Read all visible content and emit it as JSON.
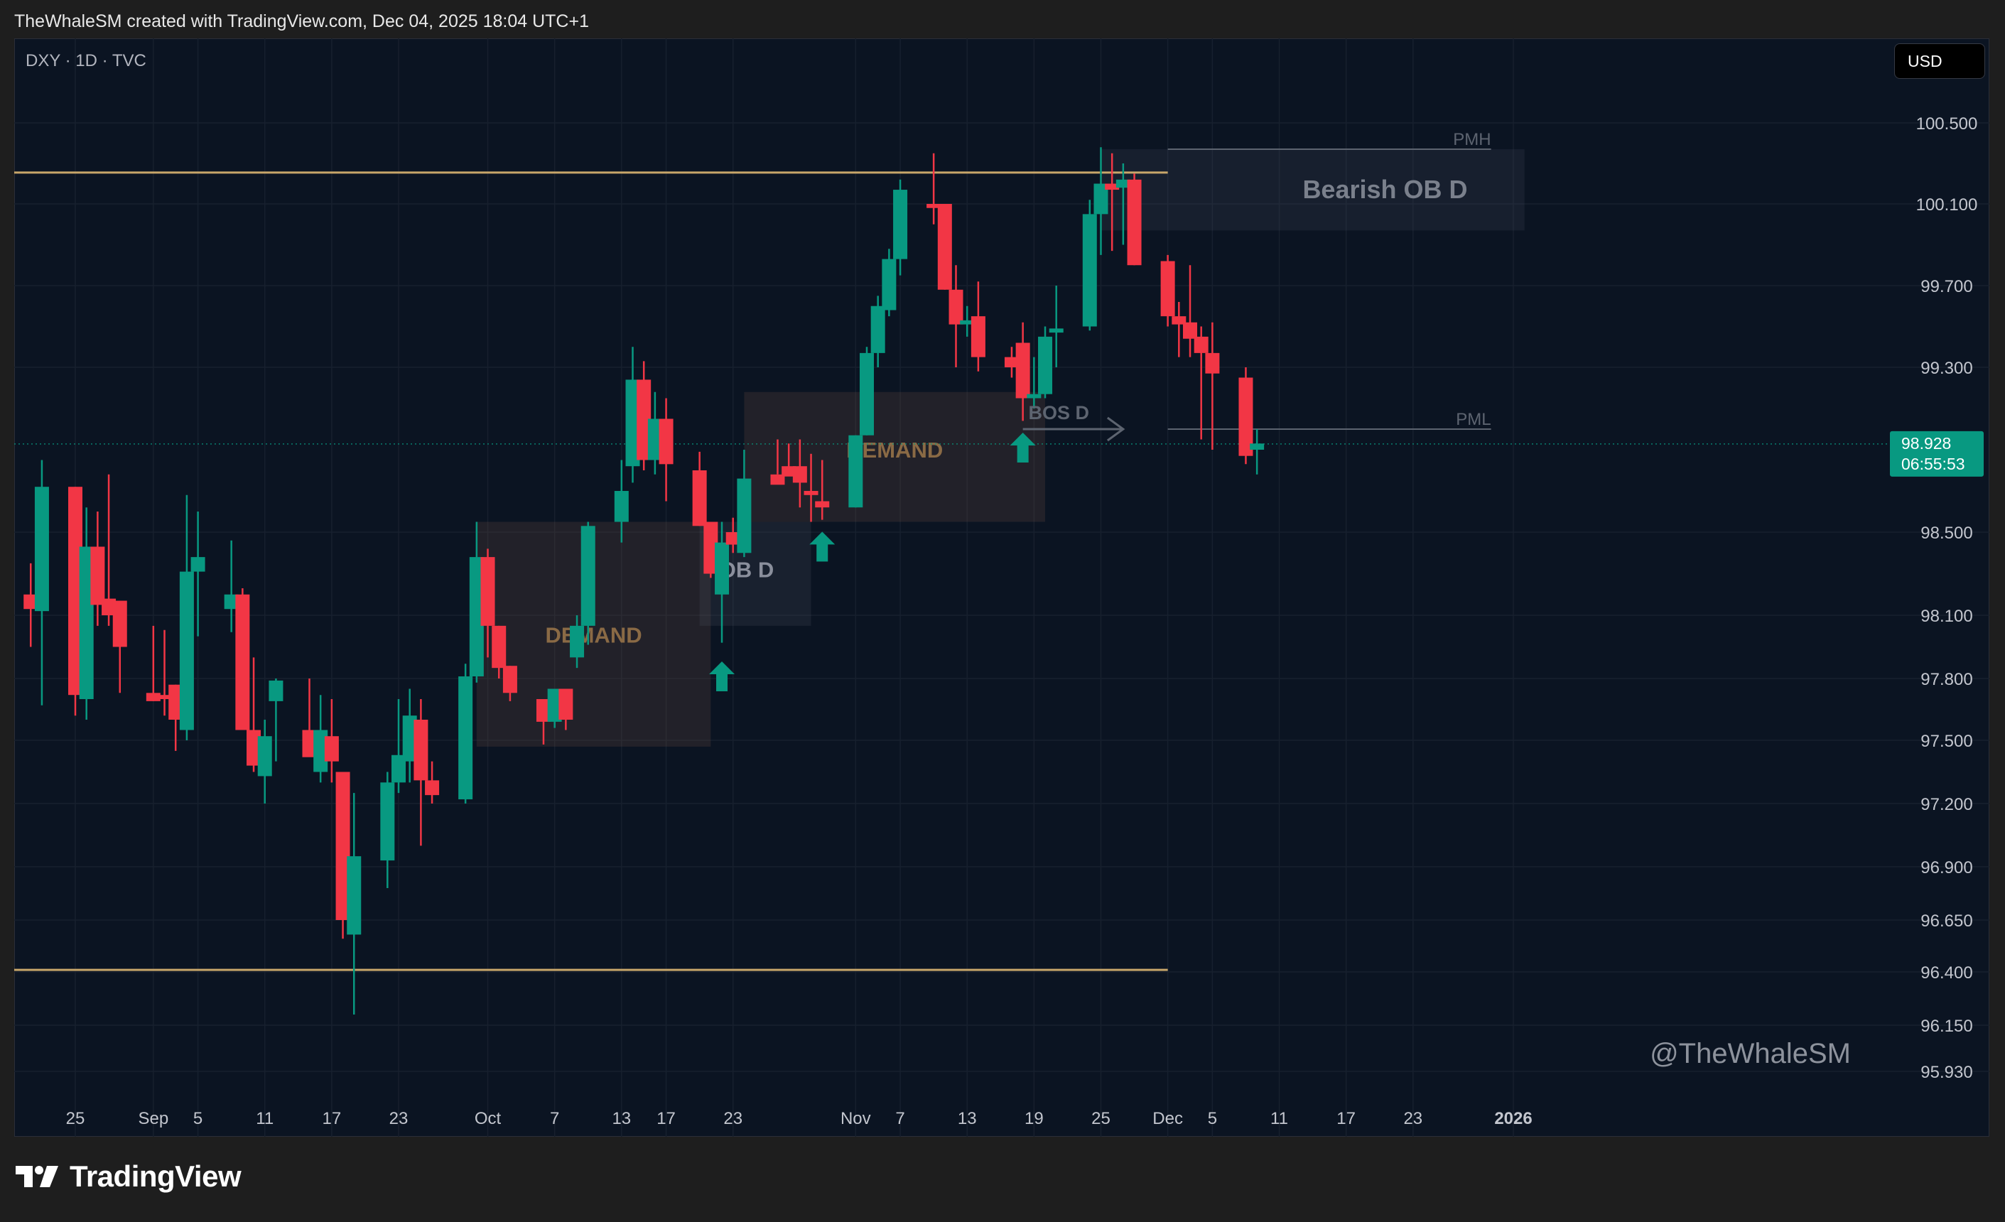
{
  "header": {
    "credit": "TheWhaleSM created with TradingView.com, Dec 04, 2025 18:04 UTC+1"
  },
  "symbol": {
    "label": "DXY · 1D · TVC"
  },
  "currency": "USD",
  "brand": {
    "name": "TradingView",
    "logo_icon": "tradingview-logo-icon"
  },
  "watermark": "@TheWhaleSM",
  "colors": {
    "up": "#089981",
    "down": "#f23645",
    "level": "#c8a66a",
    "price_badge": "#089981"
  },
  "chart_data": {
    "type": "candlestick",
    "y_ticks": [
      "100.500",
      "100.100",
      "99.700",
      "99.300",
      "98.500",
      "98.100",
      "97.800",
      "97.500",
      "97.200",
      "96.900",
      "96.650",
      "96.400",
      "96.150",
      "95.930"
    ],
    "x_ticks": [
      {
        "label": "25",
        "date": "2025-08-25"
      },
      {
        "label": "Sep",
        "date": "2025-09-01"
      },
      {
        "label": "5",
        "date": "2025-09-05"
      },
      {
        "label": "11",
        "date": "2025-09-11"
      },
      {
        "label": "17",
        "date": "2025-09-17"
      },
      {
        "label": "23",
        "date": "2025-09-23"
      },
      {
        "label": "Oct",
        "date": "2025-10-01"
      },
      {
        "label": "7",
        "date": "2025-10-07"
      },
      {
        "label": "13",
        "date": "2025-10-13"
      },
      {
        "label": "17",
        "date": "2025-10-17"
      },
      {
        "label": "23",
        "date": "2025-10-23"
      },
      {
        "label": "Nov",
        "date": "2025-11-03"
      },
      {
        "label": "7",
        "date": "2025-11-07"
      },
      {
        "label": "13",
        "date": "2025-11-13"
      },
      {
        "label": "19",
        "date": "2025-11-19"
      },
      {
        "label": "25",
        "date": "2025-11-25"
      },
      {
        "label": "Dec",
        "date": "2025-12-01"
      },
      {
        "label": "5",
        "date": "2025-12-05"
      },
      {
        "label": "11",
        "date": "2025-12-11"
      },
      {
        "label": "17",
        "date": "2025-12-17"
      },
      {
        "label": "23",
        "date": "2025-12-23"
      },
      {
        "label": "2026",
        "date": "2026-01-01"
      }
    ],
    "candles": [
      {
        "date": "2025-08-21",
        "o": 98.2,
        "h": 98.35,
        "l": 97.95,
        "c": 98.13
      },
      {
        "date": "2025-08-22",
        "o": 98.12,
        "h": 98.85,
        "l": 97.67,
        "c": 98.72
      },
      {
        "date": "2025-08-25",
        "o": 98.72,
        "h": 98.72,
        "l": 97.62,
        "c": 97.72
      },
      {
        "date": "2025-08-26",
        "o": 97.7,
        "h": 98.62,
        "l": 97.6,
        "c": 98.43
      },
      {
        "date": "2025-08-27",
        "o": 98.43,
        "h": 98.6,
        "l": 98.05,
        "c": 98.15
      },
      {
        "date": "2025-08-28",
        "o": 98.18,
        "h": 98.78,
        "l": 98.05,
        "c": 98.1
      },
      {
        "date": "2025-08-29",
        "o": 98.17,
        "h": 98.17,
        "l": 97.73,
        "c": 97.95
      },
      {
        "date": "2025-09-01",
        "o": 97.73,
        "h": 98.05,
        "l": 97.69,
        "c": 97.69
      },
      {
        "date": "2025-09-02",
        "o": 97.72,
        "h": 98.03,
        "l": 97.62,
        "c": 97.7
      },
      {
        "date": "2025-09-03",
        "o": 97.77,
        "h": 97.77,
        "l": 97.45,
        "c": 97.6
      },
      {
        "date": "2025-09-04",
        "o": 97.55,
        "h": 98.68,
        "l": 97.5,
        "c": 98.31
      },
      {
        "date": "2025-09-05",
        "o": 98.31,
        "h": 98.6,
        "l": 98.0,
        "c": 98.38
      },
      {
        "date": "2025-09-08",
        "o": 98.13,
        "h": 98.46,
        "l": 98.02,
        "c": 98.2
      },
      {
        "date": "2025-09-09",
        "o": 98.2,
        "h": 98.23,
        "l": 97.55,
        "c": 97.55
      },
      {
        "date": "2025-09-10",
        "o": 97.55,
        "h": 97.9,
        "l": 97.35,
        "c": 97.38
      },
      {
        "date": "2025-09-11",
        "o": 97.33,
        "h": 97.6,
        "l": 97.2,
        "c": 97.52
      },
      {
        "date": "2025-09-12",
        "o": 97.69,
        "h": 97.8,
        "l": 97.4,
        "c": 97.79
      },
      {
        "date": "2025-09-15",
        "o": 97.55,
        "h": 97.8,
        "l": 97.5,
        "c": 97.42
      },
      {
        "date": "2025-09-16",
        "o": 97.35,
        "h": 97.72,
        "l": 97.3,
        "c": 97.55
      },
      {
        "date": "2025-09-17",
        "o": 97.52,
        "h": 97.7,
        "l": 97.3,
        "c": 97.4
      },
      {
        "date": "2025-09-18",
        "o": 97.35,
        "h": 97.35,
        "l": 96.56,
        "c": 96.65
      },
      {
        "date": "2025-09-19",
        "o": 96.58,
        "h": 97.25,
        "l": 96.2,
        "c": 96.95
      },
      {
        "date": "2025-09-22",
        "o": 96.93,
        "h": 97.35,
        "l": 96.8,
        "c": 97.3
      },
      {
        "date": "2025-09-23",
        "o": 97.3,
        "h": 97.7,
        "l": 97.25,
        "c": 97.43
      },
      {
        "date": "2025-09-24",
        "o": 97.4,
        "h": 97.75,
        "l": 97.3,
        "c": 97.62
      },
      {
        "date": "2025-09-25",
        "o": 97.6,
        "h": 97.7,
        "l": 97.0,
        "c": 97.31
      },
      {
        "date": "2025-09-26",
        "o": 97.31,
        "h": 97.4,
        "l": 97.2,
        "c": 97.24
      },
      {
        "date": "2025-09-29",
        "o": 97.22,
        "h": 97.87,
        "l": 97.2,
        "c": 97.81
      },
      {
        "date": "2025-09-30",
        "o": 97.81,
        "h": 98.55,
        "l": 97.78,
        "c": 98.38
      },
      {
        "date": "2025-10-01",
        "o": 98.38,
        "h": 98.42,
        "l": 97.9,
        "c": 98.05
      },
      {
        "date": "2025-10-02",
        "o": 98.05,
        "h": 98.05,
        "l": 97.8,
        "c": 97.85
      },
      {
        "date": "2025-10-03",
        "o": 97.86,
        "h": 97.86,
        "l": 97.69,
        "c": 97.73
      },
      {
        "date": "2025-10-06",
        "o": 97.7,
        "h": 97.7,
        "l": 97.48,
        "c": 97.59
      },
      {
        "date": "2025-10-07",
        "o": 97.59,
        "h": 97.75,
        "l": 97.56,
        "c": 97.75
      },
      {
        "date": "2025-10-08",
        "o": 97.75,
        "h": 97.75,
        "l": 97.55,
        "c": 97.6
      },
      {
        "date": "2025-10-09",
        "o": 97.9,
        "h": 98.1,
        "l": 97.85,
        "c": 98.05
      },
      {
        "date": "2025-10-10",
        "o": 98.05,
        "h": 98.55,
        "l": 97.96,
        "c": 98.53
      },
      {
        "date": "2025-10-13",
        "o": 98.55,
        "h": 98.85,
        "l": 98.45,
        "c": 98.7
      },
      {
        "date": "2025-10-14",
        "o": 98.82,
        "h": 99.4,
        "l": 98.74,
        "c": 99.24
      },
      {
        "date": "2025-10-15",
        "o": 99.24,
        "h": 99.33,
        "l": 98.8,
        "c": 98.85
      },
      {
        "date": "2025-10-16",
        "o": 98.85,
        "h": 99.18,
        "l": 98.78,
        "c": 99.05
      },
      {
        "date": "2025-10-17",
        "o": 99.05,
        "h": 99.15,
        "l": 98.65,
        "c": 98.83
      },
      {
        "date": "2025-10-20",
        "o": 98.8,
        "h": 98.89,
        "l": 98.53,
        "c": 98.53
      },
      {
        "date": "2025-10-21",
        "o": 98.55,
        "h": 98.55,
        "l": 98.28,
        "c": 98.3
      },
      {
        "date": "2025-10-22",
        "o": 98.2,
        "h": 98.55,
        "l": 97.97,
        "c": 98.45
      },
      {
        "date": "2025-10-23",
        "o": 98.5,
        "h": 98.57,
        "l": 98.4,
        "c": 98.44
      },
      {
        "date": "2025-10-24",
        "o": 98.4,
        "h": 98.9,
        "l": 98.38,
        "c": 98.76
      },
      {
        "date": "2025-10-27",
        "o": 98.78,
        "h": 98.95,
        "l": 98.78,
        "c": 98.73
      },
      {
        "date": "2025-10-28",
        "o": 98.82,
        "h": 98.93,
        "l": 98.78,
        "c": 98.77
      },
      {
        "date": "2025-10-29",
        "o": 98.82,
        "h": 98.95,
        "l": 98.62,
        "c": 98.74
      },
      {
        "date": "2025-10-30",
        "o": 98.7,
        "h": 98.88,
        "l": 98.55,
        "c": 98.68
      },
      {
        "date": "2025-10-31",
        "o": 98.65,
        "h": 98.85,
        "l": 98.56,
        "c": 98.62
      },
      {
        "date": "2025-11-03",
        "o": 98.62,
        "h": 98.97,
        "l": 98.62,
        "c": 98.97
      },
      {
        "date": "2025-11-04",
        "o": 98.97,
        "h": 99.4,
        "l": 98.97,
        "c": 99.37
      },
      {
        "date": "2025-11-05",
        "o": 99.37,
        "h": 99.65,
        "l": 99.3,
        "c": 99.6
      },
      {
        "date": "2025-11-06",
        "o": 99.58,
        "h": 99.88,
        "l": 99.55,
        "c": 99.83
      },
      {
        "date": "2025-11-07",
        "o": 99.83,
        "h": 100.22,
        "l": 99.75,
        "c": 100.17
      },
      {
        "date": "2025-11-10",
        "o": 100.1,
        "h": 100.35,
        "l": 100.0,
        "c": 100.08
      },
      {
        "date": "2025-11-11",
        "o": 100.1,
        "h": 100.1,
        "l": 99.68,
        "c": 99.68
      },
      {
        "date": "2025-11-12",
        "o": 99.68,
        "h": 99.8,
        "l": 99.3,
        "c": 99.51
      },
      {
        "date": "2025-11-13",
        "o": 99.51,
        "h": 99.6,
        "l": 99.45,
        "c": 99.53
      },
      {
        "date": "2025-11-14",
        "o": 99.55,
        "h": 99.72,
        "l": 99.28,
        "c": 99.35
      },
      {
        "date": "2025-11-17",
        "o": 99.35,
        "h": 99.4,
        "l": 99.25,
        "c": 99.3
      },
      {
        "date": "2025-11-18",
        "o": 99.42,
        "h": 99.52,
        "l": 99.04,
        "c": 99.15
      },
      {
        "date": "2025-11-19",
        "o": 99.15,
        "h": 99.35,
        "l": 99.1,
        "c": 99.17
      },
      {
        "date": "2025-11-20",
        "o": 99.17,
        "h": 99.5,
        "l": 99.15,
        "c": 99.45
      },
      {
        "date": "2025-11-21",
        "o": 99.47,
        "h": 99.7,
        "l": 99.3,
        "c": 99.49
      },
      {
        "date": "2025-11-24",
        "o": 99.5,
        "h": 100.12,
        "l": 99.48,
        "c": 100.05
      },
      {
        "date": "2025-11-25",
        "o": 100.05,
        "h": 100.38,
        "l": 99.85,
        "c": 100.2
      },
      {
        "date": "2025-11-26",
        "o": 100.2,
        "h": 100.35,
        "l": 99.87,
        "c": 100.17
      },
      {
        "date": "2025-11-27",
        "o": 100.18,
        "h": 100.3,
        "l": 99.9,
        "c": 100.22
      },
      {
        "date": "2025-11-28",
        "o": 100.22,
        "h": 100.25,
        "l": 99.8,
        "c": 99.8
      },
      {
        "date": "2025-12-01",
        "o": 99.82,
        "h": 99.85,
        "l": 99.5,
        "c": 99.55
      },
      {
        "date": "2025-12-02",
        "o": 99.55,
        "h": 99.62,
        "l": 99.35,
        "c": 99.51
      },
      {
        "date": "2025-12-03",
        "o": 99.52,
        "h": 99.8,
        "l": 99.35,
        "c": 99.44
      },
      {
        "date": "2025-12-04",
        "o": 99.45,
        "h": 99.5,
        "l": 98.95,
        "c": 99.37
      },
      {
        "date": "2025-12-05",
        "o": 99.37,
        "h": 99.52,
        "l": 98.9,
        "c": 99.27
      },
      {
        "date": "2025-12-08",
        "o": 99.25,
        "h": 99.3,
        "l": 98.83,
        "c": 98.87
      },
      {
        "date": "2025-12-09",
        "o": 98.9,
        "h": 99.0,
        "l": 98.78,
        "c": 98.93
      }
    ],
    "horizontal_levels": [
      {
        "name": "upper-resistance",
        "price": 100.255
      },
      {
        "name": "lower-support",
        "price": 96.41
      }
    ],
    "zones": [
      {
        "label": "DEMAND",
        "kind": "demand",
        "from": "2025-09-30",
        "to": "2025-10-21",
        "low": 97.47,
        "high": 98.55
      },
      {
        "label": "OB D",
        "kind": "ob",
        "from": "2025-10-20",
        "to": "2025-10-30",
        "low": 98.05,
        "high": 98.55
      },
      {
        "label": "DEMAND",
        "kind": "demand",
        "from": "2025-10-24",
        "to": "2025-11-20",
        "low": 98.55,
        "high": 99.18
      },
      {
        "label": "Bearish OB D",
        "kind": "bearish-ob",
        "from": "2025-11-25",
        "to": "2026-01-02",
        "low": 99.97,
        "high": 100.37
      }
    ],
    "lines": [
      {
        "label": "PMH",
        "price": 100.37,
        "from": "2025-12-01",
        "to": "2025-12-30"
      },
      {
        "label": "PML",
        "price": 99.0,
        "from": "2025-12-01",
        "to": "2025-12-30"
      }
    ],
    "bos": {
      "label": "BOS D",
      "price": 99.0,
      "from": "2025-11-18",
      "to": "2025-11-27"
    },
    "arrows": [
      {
        "date": "2025-10-22",
        "price": 97.8
      },
      {
        "date": "2025-10-31",
        "price": 98.42
      },
      {
        "date": "2025-11-18",
        "price": 98.9
      }
    ],
    "current_price": {
      "price": 98.928,
      "value": "98.928",
      "timer": "06:55:53"
    }
  }
}
